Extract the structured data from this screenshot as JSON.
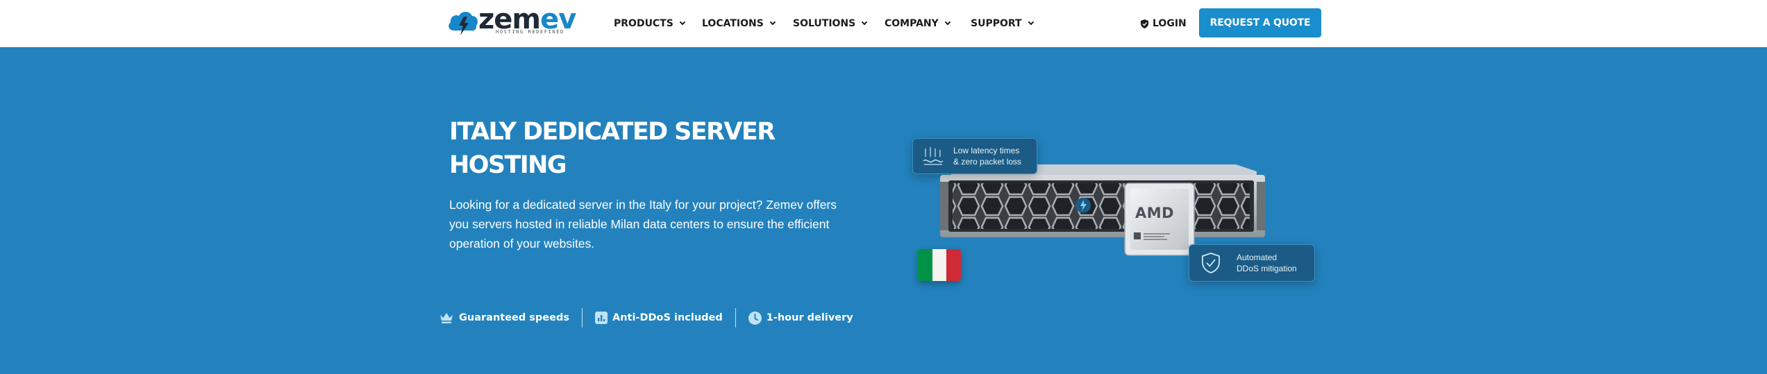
{
  "header": {
    "logo": {
      "word_a": "zem",
      "word_b": "ev",
      "tagline": "HOSTING REDEFINED"
    },
    "nav": [
      {
        "label": "PRODUCTS"
      },
      {
        "label": "LOCATIONS"
      },
      {
        "label": "SOLUTIONS"
      },
      {
        "label": "COMPANY"
      },
      {
        "label": "SUPPORT"
      }
    ],
    "login_label": "LOGIN",
    "quote_label": "REQUEST A QUOTE"
  },
  "hero": {
    "title_line1": "ITALY DEDICATED SERVER",
    "title_line2": "HOSTING",
    "desc_line1": "Looking for a dedicated server in the Italy for your project? Zemev offers",
    "desc_line2": "you servers hosted in reliable Milan data centers to ensure the efficient",
    "desc_line3": "operation of your websites."
  },
  "features": [
    {
      "label": "Guaranteed speeds",
      "icon": "crown-icon"
    },
    {
      "label": "Anti-DDoS included",
      "icon": "chart-icon"
    },
    {
      "label": "1-hour delivery",
      "icon": "clock-icon"
    }
  ],
  "art": {
    "card1_line1": "Low latency times",
    "card1_line2": "& zero packet loss",
    "card2_line1": "Automated",
    "card2_line2": "DDoS mitigation",
    "chip_brand": "AMD"
  },
  "colors": {
    "hero_bg": "#2382bd",
    "brand_blue": "#1a8dcc",
    "flag_green": "#009246",
    "flag_white": "#f4f5f0",
    "flag_red": "#ce2b37"
  }
}
